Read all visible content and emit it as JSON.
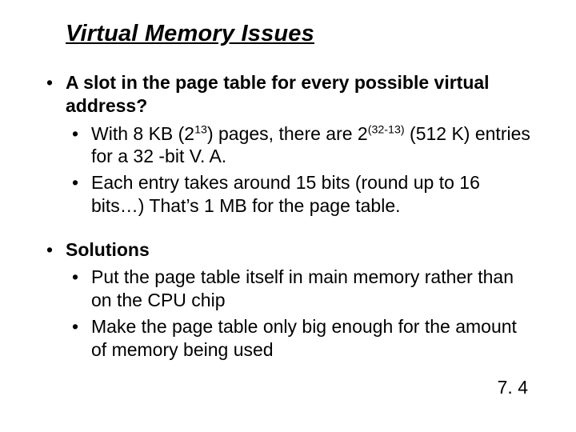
{
  "title": "Virtual Memory Issues",
  "group1": {
    "lead": "A slot in the page table for every possible virtual address?",
    "sub1_a": "With 8 KB (2",
    "sub1_sup1": "13",
    "sub1_b": ") pages, there are 2",
    "sub1_sup2": "(32-13)",
    "sub1_c": " (512 K) entries for a 32 -bit V. A.",
    "sub2": "Each entry takes around 15 bits (round up to 16 bits…)  That’s 1 MB for the page table."
  },
  "group2": {
    "lead": "Solutions",
    "sub1": "Put the page table itself in main memory rather than on the CPU chip",
    "sub2": "Make the page table only big enough for the amount of memory being used"
  },
  "pagenum": "7. 4"
}
